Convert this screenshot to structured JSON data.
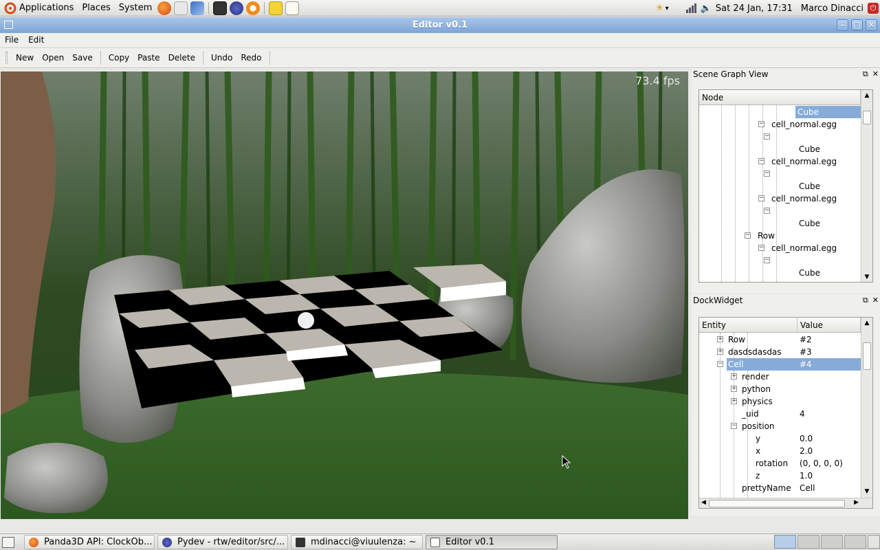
{
  "panel": {
    "applications": "Applications",
    "places": "Places",
    "system": "System",
    "datetime": "Sat 24 Jan, 17:31",
    "user": "Marco Dinacci"
  },
  "window": {
    "title": "Editor v0.1"
  },
  "menubar": {
    "file": "File",
    "edit": "Edit"
  },
  "toolbar": {
    "new": "New",
    "open": "Open",
    "save": "Save",
    "copy": "Copy",
    "paste": "Paste",
    "delete": "Delete",
    "undo": "Undo",
    "redo": "Redo"
  },
  "viewport": {
    "fps": "73.4 fps"
  },
  "scene_graph": {
    "title": "Scene Graph View",
    "header": "Node",
    "rows": [
      {
        "label": "Cube",
        "selected": true
      },
      {
        "label": "cell_normal.egg"
      },
      {
        "label": ""
      },
      {
        "label": "Cube"
      },
      {
        "label": "cell_normal.egg"
      },
      {
        "label": ""
      },
      {
        "label": "Cube"
      },
      {
        "label": "cell_normal.egg"
      },
      {
        "label": ""
      },
      {
        "label": "Cube"
      },
      {
        "label": "Row"
      },
      {
        "label": "cell_normal.egg"
      },
      {
        "label": ""
      },
      {
        "label": "Cube"
      }
    ]
  },
  "dock_widget": {
    "title": "DockWidget",
    "col_entity": "Entity",
    "col_value": "Value",
    "rows": [
      {
        "entity": "Row",
        "value": "#2"
      },
      {
        "entity": "dasdsdasdas",
        "value": "#3"
      },
      {
        "entity": "Cell",
        "value": "#4",
        "selected": true
      },
      {
        "entity": "render",
        "value": ""
      },
      {
        "entity": "python",
        "value": ""
      },
      {
        "entity": "physics",
        "value": ""
      },
      {
        "entity": "_uid",
        "value": "4"
      },
      {
        "entity": "position",
        "value": ""
      },
      {
        "entity": "y",
        "value": "0.0"
      },
      {
        "entity": "x",
        "value": "2.0"
      },
      {
        "entity": "rotation",
        "value": "(0, 0, 0, 0)"
      },
      {
        "entity": "z",
        "value": "1.0"
      },
      {
        "entity": "prettyName",
        "value": "Cell"
      }
    ]
  },
  "taskbar": {
    "tasks": [
      {
        "label": "Panda3D API: ClockOb..."
      },
      {
        "label": "Pydev - rtw/editor/src/..."
      },
      {
        "label": "mdinacci@viuulenza: ~"
      },
      {
        "label": "Editor v0.1",
        "active": true
      }
    ]
  }
}
